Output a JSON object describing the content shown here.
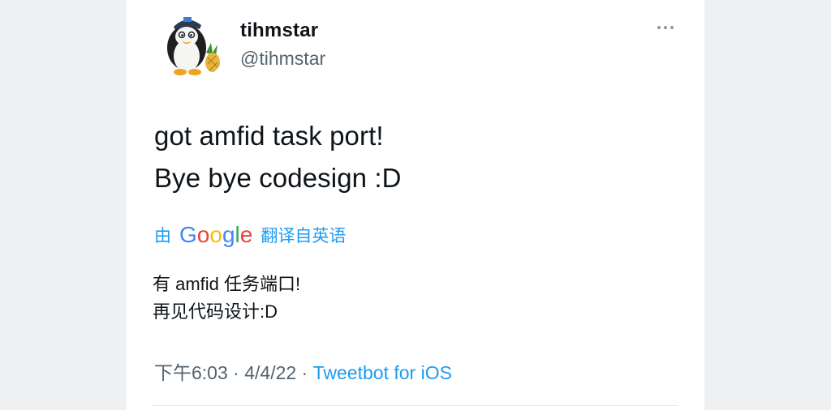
{
  "user": {
    "display_name": "tihmstar",
    "handle": "@tihmstar",
    "avatar_icon": "penguin-avatar-icon"
  },
  "more_button_icon": "more-options-icon",
  "tweet": {
    "lines": [
      "got amfid task port!",
      "Bye bye codesign :D"
    ]
  },
  "translation": {
    "prefix": "由",
    "provider": "Google",
    "suffix": "翻译自英语",
    "lines": [
      "有 amfid 任务端口!",
      "再见代码设计:D"
    ]
  },
  "meta": {
    "time": "下午6:03",
    "separator": "·",
    "date": "4/4/22",
    "source": "Tweetbot for iOS"
  },
  "colors": {
    "link": "#1d9bf0",
    "muted_text": "#536471",
    "text": "#0f1419",
    "background": "#eef0f2",
    "card": "#ffffff"
  }
}
